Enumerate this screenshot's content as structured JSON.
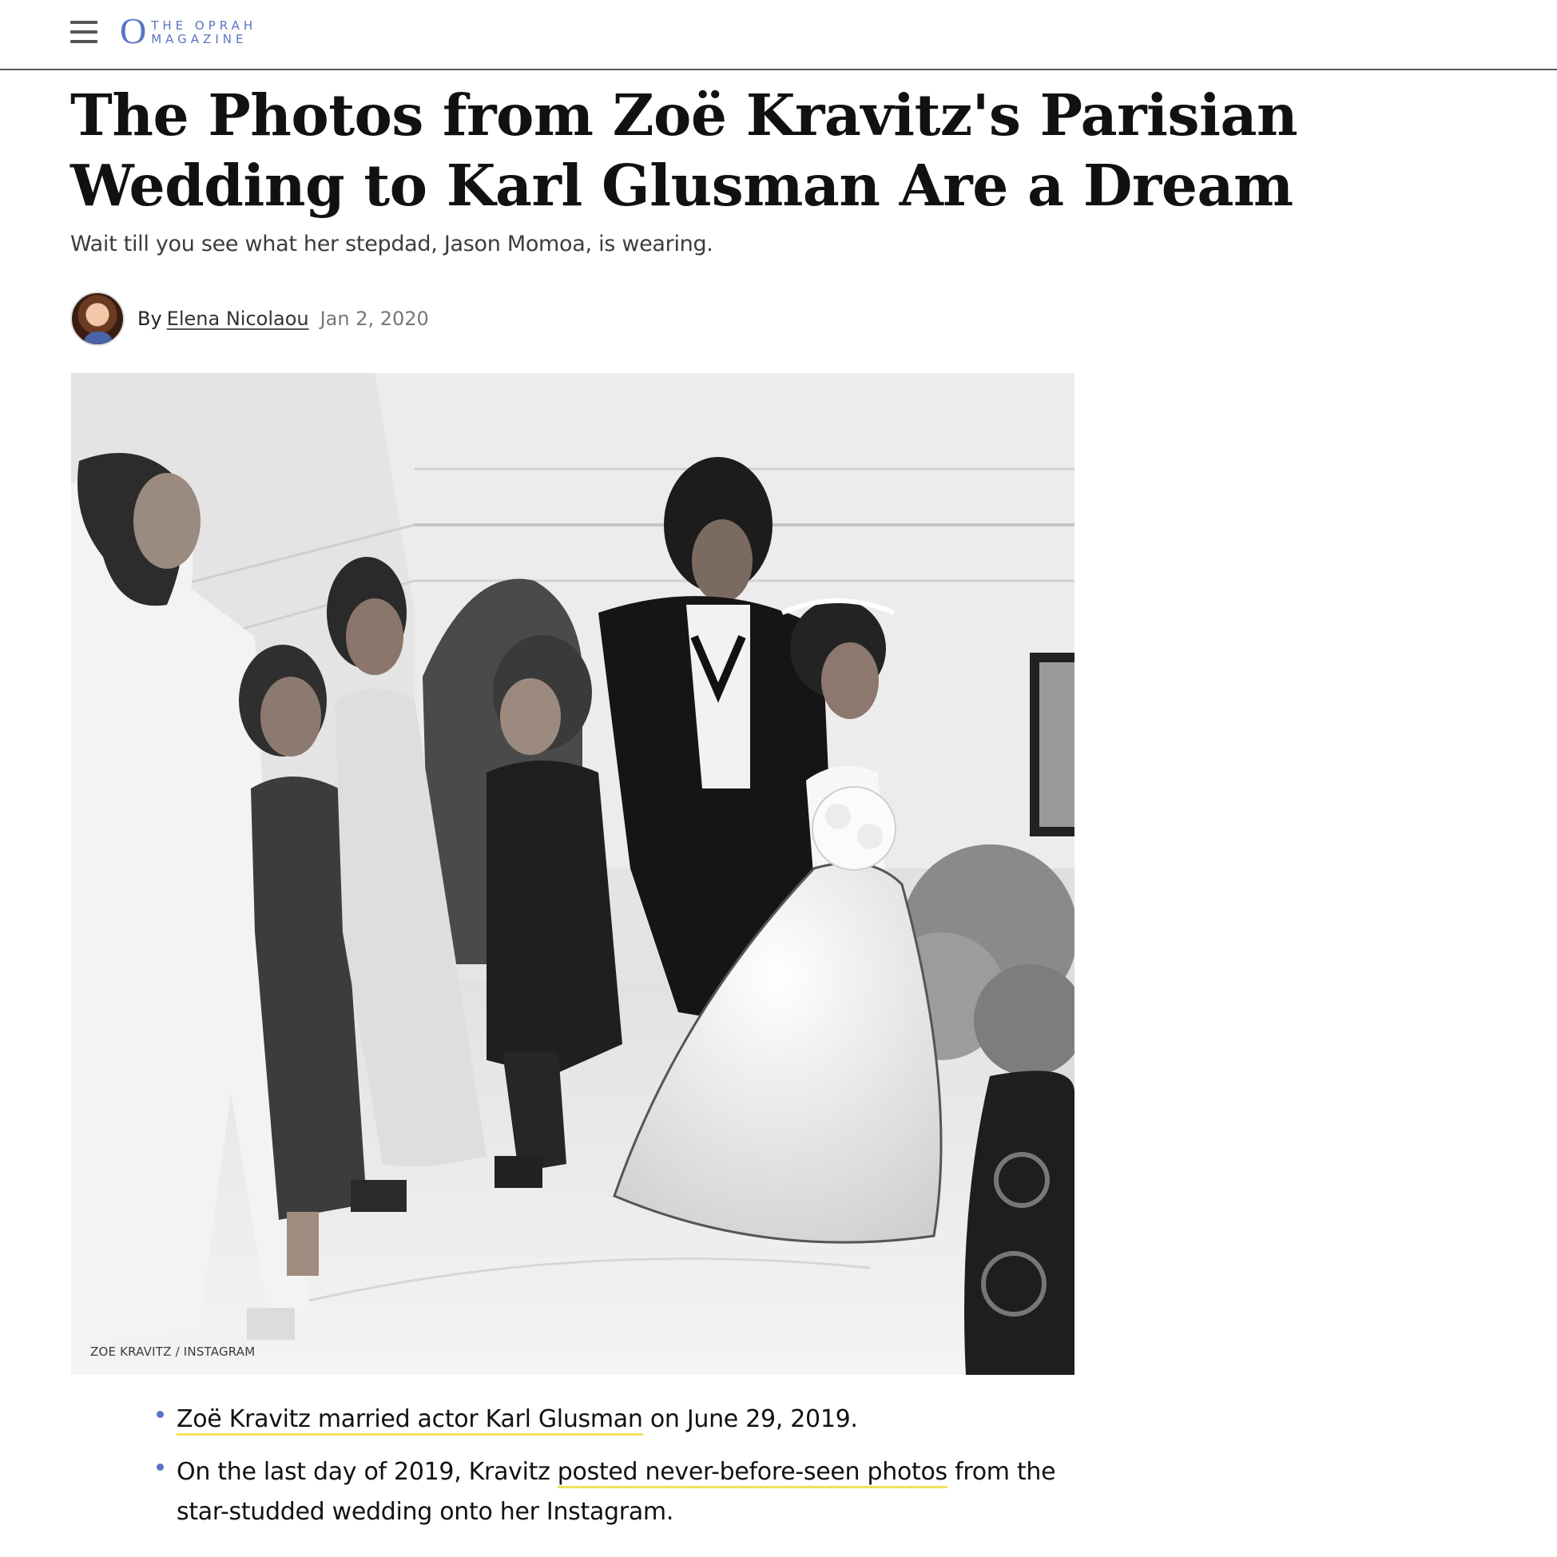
{
  "header": {
    "logo_mark": "O",
    "logo_line1": "THE OPRAH",
    "logo_line2": "MAGAZINE",
    "menu_icon": "hamburger-menu-icon"
  },
  "article": {
    "headline": "The Photos from Zoë Kravitz's Parisian Wedding to Karl Glusman Are a Dream",
    "dek": "Wait till you see what her stepdad, Jason Momoa, is wearing.",
    "byline": {
      "prefix": "By",
      "author": "Elena Nicolaou",
      "date": "Jan 2, 2020"
    },
    "photo": {
      "credit": "ZOE KRAVITZ / INSTAGRAM"
    },
    "bullets": [
      {
        "link": "Zoë Kravitz married actor Karl Glusman",
        "after": " on June 29, 2019."
      },
      {
        "before": "On the last day of 2019, Kravitz ",
        "link": "posted never-before-seen photos",
        "after": " from the star-studded wedding onto her Instagram."
      }
    ]
  },
  "colors": {
    "brand_blue": "#5a74c4",
    "link_highlight": "#f0e15a",
    "header_rule": "#5a5a5a"
  }
}
